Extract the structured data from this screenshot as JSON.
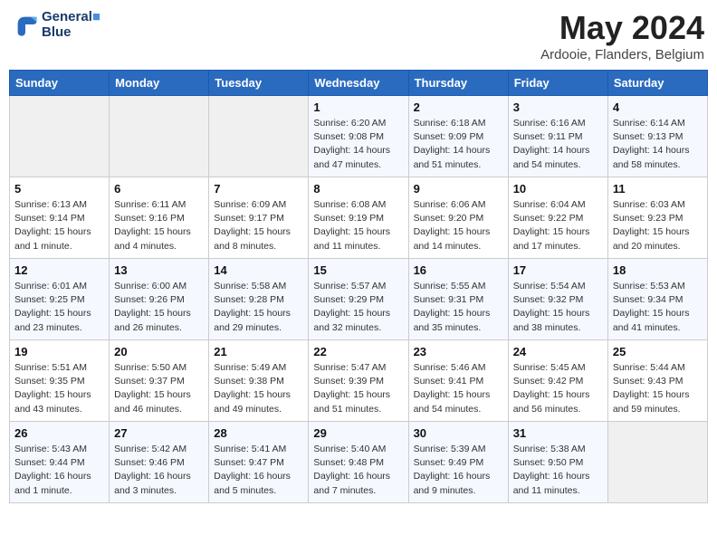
{
  "logo": {
    "line1": "General",
    "line2": "Blue"
  },
  "title": "May 2024",
  "location": "Ardooie, Flanders, Belgium",
  "days_header": [
    "Sunday",
    "Monday",
    "Tuesday",
    "Wednesday",
    "Thursday",
    "Friday",
    "Saturday"
  ],
  "weeks": [
    [
      {
        "day": "",
        "sunrise": "",
        "sunset": "",
        "daylight": ""
      },
      {
        "day": "",
        "sunrise": "",
        "sunset": "",
        "daylight": ""
      },
      {
        "day": "",
        "sunrise": "",
        "sunset": "",
        "daylight": ""
      },
      {
        "day": "1",
        "sunrise": "Sunrise: 6:20 AM",
        "sunset": "Sunset: 9:08 PM",
        "daylight": "Daylight: 14 hours and 47 minutes."
      },
      {
        "day": "2",
        "sunrise": "Sunrise: 6:18 AM",
        "sunset": "Sunset: 9:09 PM",
        "daylight": "Daylight: 14 hours and 51 minutes."
      },
      {
        "day": "3",
        "sunrise": "Sunrise: 6:16 AM",
        "sunset": "Sunset: 9:11 PM",
        "daylight": "Daylight: 14 hours and 54 minutes."
      },
      {
        "day": "4",
        "sunrise": "Sunrise: 6:14 AM",
        "sunset": "Sunset: 9:13 PM",
        "daylight": "Daylight: 14 hours and 58 minutes."
      }
    ],
    [
      {
        "day": "5",
        "sunrise": "Sunrise: 6:13 AM",
        "sunset": "Sunset: 9:14 PM",
        "daylight": "Daylight: 15 hours and 1 minute."
      },
      {
        "day": "6",
        "sunrise": "Sunrise: 6:11 AM",
        "sunset": "Sunset: 9:16 PM",
        "daylight": "Daylight: 15 hours and 4 minutes."
      },
      {
        "day": "7",
        "sunrise": "Sunrise: 6:09 AM",
        "sunset": "Sunset: 9:17 PM",
        "daylight": "Daylight: 15 hours and 8 minutes."
      },
      {
        "day": "8",
        "sunrise": "Sunrise: 6:08 AM",
        "sunset": "Sunset: 9:19 PM",
        "daylight": "Daylight: 15 hours and 11 minutes."
      },
      {
        "day": "9",
        "sunrise": "Sunrise: 6:06 AM",
        "sunset": "Sunset: 9:20 PM",
        "daylight": "Daylight: 15 hours and 14 minutes."
      },
      {
        "day": "10",
        "sunrise": "Sunrise: 6:04 AM",
        "sunset": "Sunset: 9:22 PM",
        "daylight": "Daylight: 15 hours and 17 minutes."
      },
      {
        "day": "11",
        "sunrise": "Sunrise: 6:03 AM",
        "sunset": "Sunset: 9:23 PM",
        "daylight": "Daylight: 15 hours and 20 minutes."
      }
    ],
    [
      {
        "day": "12",
        "sunrise": "Sunrise: 6:01 AM",
        "sunset": "Sunset: 9:25 PM",
        "daylight": "Daylight: 15 hours and 23 minutes."
      },
      {
        "day": "13",
        "sunrise": "Sunrise: 6:00 AM",
        "sunset": "Sunset: 9:26 PM",
        "daylight": "Daylight: 15 hours and 26 minutes."
      },
      {
        "day": "14",
        "sunrise": "Sunrise: 5:58 AM",
        "sunset": "Sunset: 9:28 PM",
        "daylight": "Daylight: 15 hours and 29 minutes."
      },
      {
        "day": "15",
        "sunrise": "Sunrise: 5:57 AM",
        "sunset": "Sunset: 9:29 PM",
        "daylight": "Daylight: 15 hours and 32 minutes."
      },
      {
        "day": "16",
        "sunrise": "Sunrise: 5:55 AM",
        "sunset": "Sunset: 9:31 PM",
        "daylight": "Daylight: 15 hours and 35 minutes."
      },
      {
        "day": "17",
        "sunrise": "Sunrise: 5:54 AM",
        "sunset": "Sunset: 9:32 PM",
        "daylight": "Daylight: 15 hours and 38 minutes."
      },
      {
        "day": "18",
        "sunrise": "Sunrise: 5:53 AM",
        "sunset": "Sunset: 9:34 PM",
        "daylight": "Daylight: 15 hours and 41 minutes."
      }
    ],
    [
      {
        "day": "19",
        "sunrise": "Sunrise: 5:51 AM",
        "sunset": "Sunset: 9:35 PM",
        "daylight": "Daylight: 15 hours and 43 minutes."
      },
      {
        "day": "20",
        "sunrise": "Sunrise: 5:50 AM",
        "sunset": "Sunset: 9:37 PM",
        "daylight": "Daylight: 15 hours and 46 minutes."
      },
      {
        "day": "21",
        "sunrise": "Sunrise: 5:49 AM",
        "sunset": "Sunset: 9:38 PM",
        "daylight": "Daylight: 15 hours and 49 minutes."
      },
      {
        "day": "22",
        "sunrise": "Sunrise: 5:47 AM",
        "sunset": "Sunset: 9:39 PM",
        "daylight": "Daylight: 15 hours and 51 minutes."
      },
      {
        "day": "23",
        "sunrise": "Sunrise: 5:46 AM",
        "sunset": "Sunset: 9:41 PM",
        "daylight": "Daylight: 15 hours and 54 minutes."
      },
      {
        "day": "24",
        "sunrise": "Sunrise: 5:45 AM",
        "sunset": "Sunset: 9:42 PM",
        "daylight": "Daylight: 15 hours and 56 minutes."
      },
      {
        "day": "25",
        "sunrise": "Sunrise: 5:44 AM",
        "sunset": "Sunset: 9:43 PM",
        "daylight": "Daylight: 15 hours and 59 minutes."
      }
    ],
    [
      {
        "day": "26",
        "sunrise": "Sunrise: 5:43 AM",
        "sunset": "Sunset: 9:44 PM",
        "daylight": "Daylight: 16 hours and 1 minute."
      },
      {
        "day": "27",
        "sunrise": "Sunrise: 5:42 AM",
        "sunset": "Sunset: 9:46 PM",
        "daylight": "Daylight: 16 hours and 3 minutes."
      },
      {
        "day": "28",
        "sunrise": "Sunrise: 5:41 AM",
        "sunset": "Sunset: 9:47 PM",
        "daylight": "Daylight: 16 hours and 5 minutes."
      },
      {
        "day": "29",
        "sunrise": "Sunrise: 5:40 AM",
        "sunset": "Sunset: 9:48 PM",
        "daylight": "Daylight: 16 hours and 7 minutes."
      },
      {
        "day": "30",
        "sunrise": "Sunrise: 5:39 AM",
        "sunset": "Sunset: 9:49 PM",
        "daylight": "Daylight: 16 hours and 9 minutes."
      },
      {
        "day": "31",
        "sunrise": "Sunrise: 5:38 AM",
        "sunset": "Sunset: 9:50 PM",
        "daylight": "Daylight: 16 hours and 11 minutes."
      },
      {
        "day": "",
        "sunrise": "",
        "sunset": "",
        "daylight": ""
      }
    ]
  ]
}
